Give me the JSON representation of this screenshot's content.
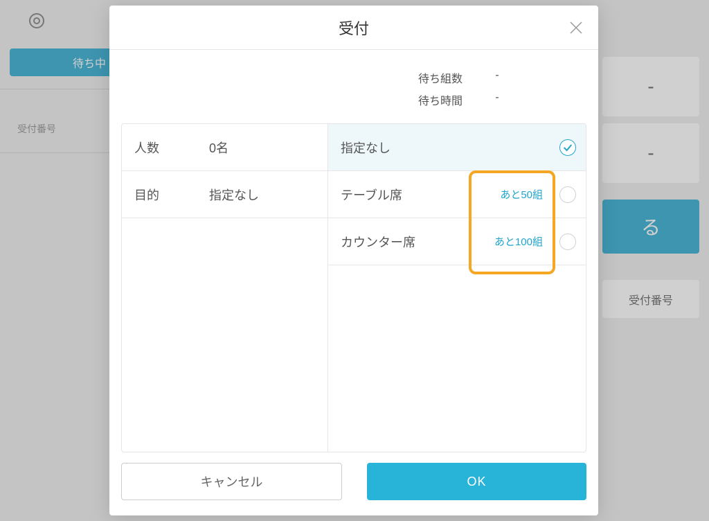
{
  "background": {
    "status_button": "待ち中",
    "side_label": "受付番号",
    "card1": "-",
    "card2": "-",
    "big_button": "る",
    "card3": "受付番号"
  },
  "modal": {
    "title": "受付",
    "stats": {
      "row1_label": "待ち組数",
      "row1_value": "-",
      "row2_label": "待ち時間",
      "row2_value": "-"
    },
    "left": {
      "r1_field": "人数",
      "r1_val": "0名",
      "r2_field": "目的",
      "r2_val": "指定なし"
    },
    "options": {
      "o1_label": "指定なし",
      "o2_label": "テーブル席",
      "o2_remaining": "あと50組",
      "o3_label": "カウンター席",
      "o3_remaining": "あと100組"
    },
    "buttons": {
      "cancel": "キャンセル",
      "ok": "OK"
    }
  }
}
